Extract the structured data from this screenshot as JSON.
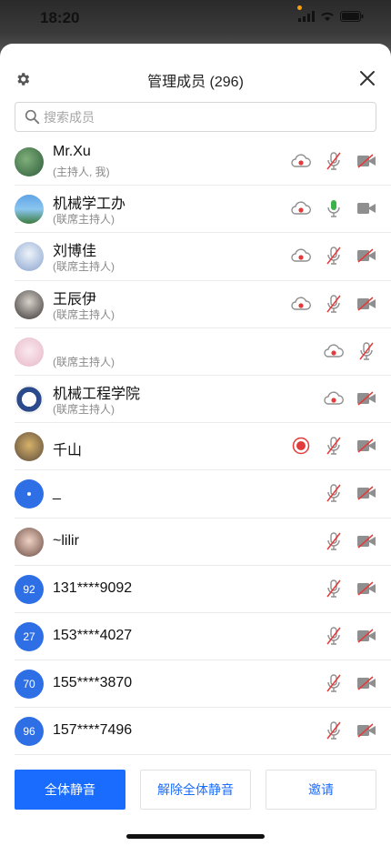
{
  "status": {
    "time": "18:20"
  },
  "header": {
    "title": "管理成员 (296)"
  },
  "search": {
    "placeholder": "搜索成员"
  },
  "members": [
    {
      "name": "Mr.Xu",
      "role": "(主持人, 我)",
      "avatar": "photo-green",
      "icons": [
        "cloud-record",
        "mic-off",
        "video-off"
      ]
    },
    {
      "name": "机械学工办",
      "role": "(联席主持人)",
      "avatar": "photo-campus",
      "icons": [
        "cloud-record",
        "mic-on",
        "video-on"
      ]
    },
    {
      "name": "刘博佳",
      "role": "(联席主持人)",
      "avatar": "photo-anime",
      "icons": [
        "cloud-record",
        "mic-off",
        "video-off"
      ]
    },
    {
      "name": "王辰伊",
      "role": "(联席主持人)",
      "avatar": "photo-girl",
      "icons": [
        "cloud-record",
        "mic-off",
        "video-off"
      ]
    },
    {
      "name": "",
      "role": "(联席主持人)",
      "avatar": "photo-pink",
      "icons": [
        "cloud-record",
        "mic-off"
      ]
    },
    {
      "name": "机械工程学院",
      "role": "(联席主持人)",
      "avatar": "photo-emblem",
      "icons": [
        "cloud-record",
        "video-off"
      ]
    },
    {
      "name": "千山",
      "role": "",
      "avatar": "photo-pet",
      "icons": [
        "local-record",
        "mic-off",
        "video-off"
      ]
    },
    {
      "name": "_",
      "role": "",
      "avatar": "blue-dot",
      "icons": [
        "mic-off",
        "video-off"
      ]
    },
    {
      "name": "~lilir",
      "role": "",
      "avatar": "photo-face",
      "icons": [
        "mic-off",
        "video-off"
      ]
    },
    {
      "name": "131****9092",
      "role": "",
      "avatar": "92",
      "icons": [
        "mic-off",
        "video-off"
      ]
    },
    {
      "name": "153****4027",
      "role": "",
      "avatar": "27",
      "icons": [
        "mic-off",
        "video-off"
      ]
    },
    {
      "name": "155****3870",
      "role": "",
      "avatar": "70",
      "icons": [
        "mic-off",
        "video-off"
      ]
    },
    {
      "name": "157****7496",
      "role": "",
      "avatar": "96",
      "icons": [
        "mic-off",
        "video-off"
      ]
    }
  ],
  "footer": {
    "mute_all": "全体静音",
    "unmute_all": "解除全体静音",
    "invite": "邀请"
  },
  "colors": {
    "accent": "#1a6cff",
    "record": "#e33b3b",
    "mic_on": "#3cb34a",
    "icon_gray": "#8f8f8f"
  }
}
